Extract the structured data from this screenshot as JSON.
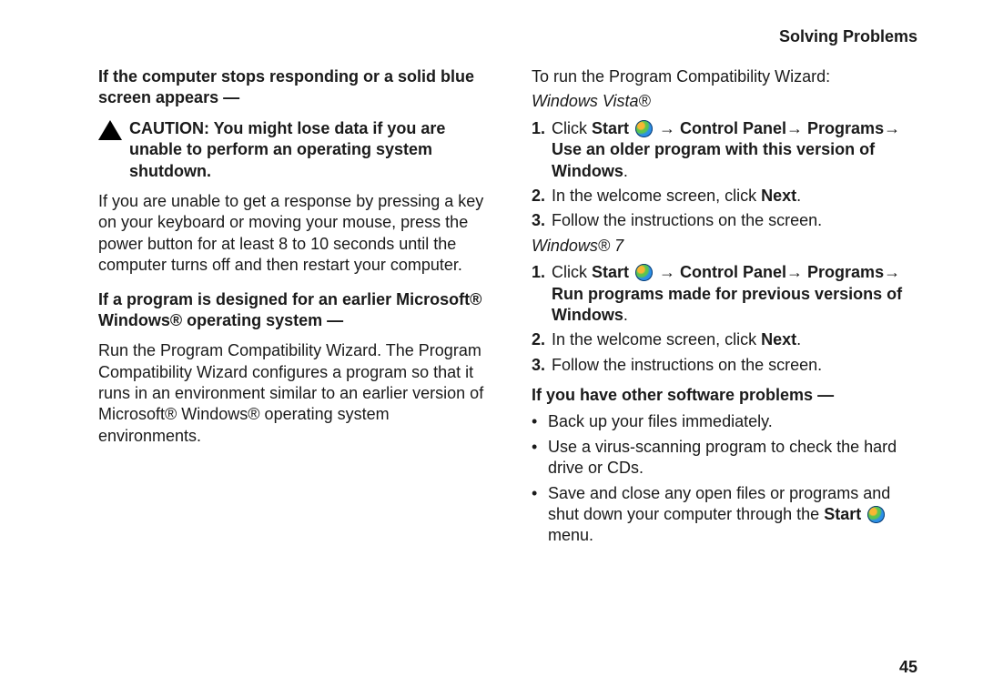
{
  "header": "Solving Problems",
  "pageNumber": "45",
  "left": {
    "h1": "If the computer stops responding or a solid blue screen appears —",
    "caution": "CAUTION: You might lose data if you are unable to perform an operating system shutdown.",
    "p1": "If you are unable to get a response by pressing a key on your keyboard or moving your mouse, press the power button for at least 8 to 10 seconds until the computer turns off and then restart your computer.",
    "h2": "If a program is designed for an earlier Microsoft® Windows® operating system —",
    "p2": "Run the Program Compatibility Wizard. The Program Compatibility Wizard configures a program so that it runs in an environment similar to an earlier version of Microsoft® Windows® operating system environments."
  },
  "right": {
    "intro": "To run the Program Compatibility Wizard:",
    "vista": {
      "title": "Windows Vista®",
      "s1_pre": "Click ",
      "s1_start": "Start",
      "s1_post": " → Control Panel→ Programs→ Use an older program with this version of Windows",
      "s1_end": ".",
      "s2_pre": "In the welcome screen, click ",
      "s2_next": "Next",
      "s2_end": ".",
      "s3": "Follow the instructions on the screen."
    },
    "win7": {
      "title": "Windows® 7",
      "s1_pre": "Click ",
      "s1_start": "Start",
      "s1_post": " → Control Panel→ Programs→ Run programs made for previous versions of Windows",
      "s1_end": ".",
      "s2_pre": "In the welcome screen, click ",
      "s2_next": "Next",
      "s2_end": ".",
      "s3": "Follow the instructions on the screen."
    },
    "otherHeading": "If you have other software problems —",
    "b1": "Back up your files immediately.",
    "b2": "Use a virus-scanning program to check the hard drive or CDs.",
    "b3_pre": "Save and close any open files or programs and shut down your computer through the ",
    "b3_start": "Start",
    "b3_post": " menu."
  }
}
